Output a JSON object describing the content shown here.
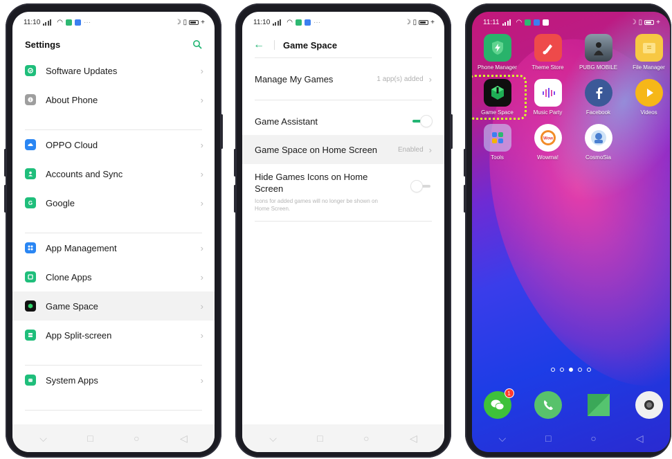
{
  "colors": {
    "accent": "#22b573",
    "highlight_outline": "#d8ff2c"
  },
  "phone1": {
    "status": {
      "time": "11:10"
    },
    "title": "Settings",
    "search_icon": "search-icon",
    "groups": [
      [
        {
          "label": "Software Updates",
          "icon": "update-icon",
          "color": "#1fbe7b"
        },
        {
          "label": "About Phone",
          "icon": "info-icon",
          "color": "#9e9e9e"
        }
      ],
      [
        {
          "label": "OPPO Cloud",
          "icon": "cloud-icon",
          "color": "#2a86f3"
        },
        {
          "label": "Accounts and Sync",
          "icon": "user-icon",
          "color": "#1fbe7b"
        },
        {
          "label": "Google",
          "icon": "google-icon",
          "color": "#1fbe7b"
        }
      ],
      [
        {
          "label": "App Management",
          "icon": "grid-icon",
          "color": "#2a86f3"
        },
        {
          "label": "Clone Apps",
          "icon": "clone-icon",
          "color": "#1fbe7b"
        },
        {
          "label": "Game Space",
          "icon": "game-space-icon",
          "color": "#111111"
        },
        {
          "label": "App Split-screen",
          "icon": "split-screen-icon",
          "color": "#1fbe7b"
        }
      ],
      [
        {
          "label": "System Apps",
          "icon": "system-apps-icon",
          "color": "#1fbe7b"
        }
      ]
    ]
  },
  "phone2": {
    "status": {
      "time": "11:10"
    },
    "title": "Game Space",
    "manage": {
      "label": "Manage My Games",
      "value": "1 app(s) added"
    },
    "assistant": {
      "label": "Game Assistant",
      "state": true
    },
    "home_screen": {
      "label": "Game Space on Home Screen",
      "value": "Enabled"
    },
    "hide_icons": {
      "label": "Hide Games Icons on Home Screen",
      "description": "Icons for added games will no longer be shown on Home Screen.",
      "state": false
    }
  },
  "phone3": {
    "status": {
      "time": "11:11"
    },
    "apps": [
      {
        "name": "Phone Manager",
        "icon": "shield-bolt-icon",
        "color": "#29b36b"
      },
      {
        "name": "Theme Store",
        "icon": "brush-icon",
        "color": "#ee4a4a"
      },
      {
        "name": "PUBG MOBILE",
        "icon": "pubg-icon",
        "color": "#6a7a8a"
      },
      {
        "name": "File Manager",
        "icon": "folder-icon",
        "color": "#f7c843"
      },
      {
        "name": "Game Space",
        "icon": "game-space-icon",
        "color": "#0f0f0f"
      },
      {
        "name": "Music Party",
        "icon": "music-party-icon",
        "color": "#ffffff"
      },
      {
        "name": "Facebook",
        "icon": "facebook-icon",
        "color": "#3b5998"
      },
      {
        "name": "Videos",
        "icon": "play-icon",
        "color": "#f6b718"
      },
      {
        "name": "Tools",
        "icon": "tools-folder-icon",
        "color": "#7fb4f0"
      },
      {
        "name": "Wowma!",
        "icon": "wowma-icon",
        "color": "#ffffff"
      },
      {
        "name": "CosmoSia",
        "icon": "cosmosia-icon",
        "color": "#ffffff"
      }
    ],
    "page_dots": 5,
    "active_dot": 2,
    "dock": [
      {
        "name": "WeChat",
        "icon": "wechat-icon",
        "color": "#3ec13a",
        "badge": "1"
      },
      {
        "name": "Phone",
        "icon": "phone-icon",
        "color": "#58c26b",
        "badge": ""
      },
      {
        "name": "Messages",
        "icon": "message-icon",
        "color": "#3aa858",
        "badge": ""
      },
      {
        "name": "Camera",
        "icon": "camera-icon",
        "color": "#f0f0f0",
        "badge": ""
      }
    ]
  }
}
